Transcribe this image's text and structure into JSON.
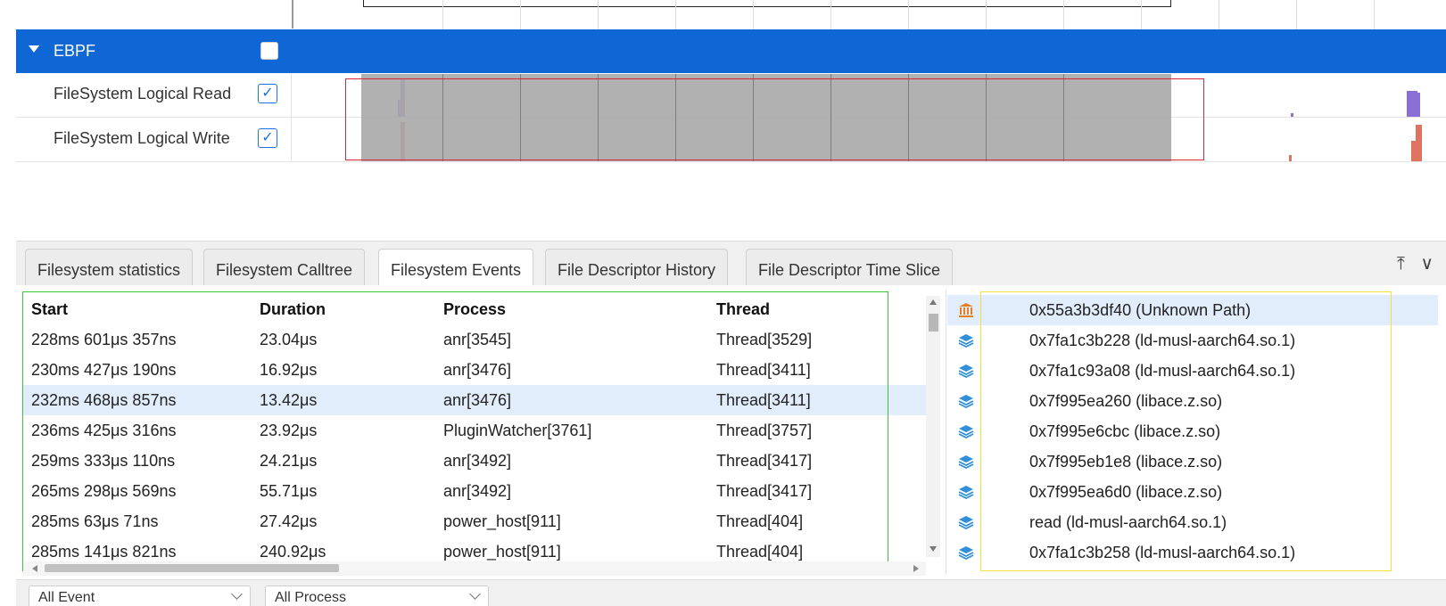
{
  "timeline": {
    "ebpf_group": {
      "label": "EBPF",
      "checked": false
    },
    "rows": [
      {
        "label": "FileSystem Logical Read",
        "checked": true,
        "bar_color": "#8a6fd6"
      },
      {
        "label": "FileSystem Logical Write",
        "checked": true,
        "bar_color": "#e0735f"
      }
    ],
    "selection_color": "#a9a9a9",
    "highlight_box_color": "#d9263a"
  },
  "tabs": [
    {
      "label": "Filesystem statistics",
      "active": false
    },
    {
      "label": "Filesystem Calltree",
      "active": false
    },
    {
      "label": "Filesystem Events",
      "active": true
    },
    {
      "label": "File Descriptor History",
      "active": false
    },
    {
      "label": "File Descriptor Time Slice",
      "active": false
    }
  ],
  "tab_icons": [
    "pin-top-icon",
    "chevron-down-icon"
  ],
  "events_table": {
    "columns": [
      "Start",
      "Duration",
      "Process",
      "Thread"
    ],
    "rows": [
      [
        "228ms 601μs 357ns",
        "23.04μs",
        "anr[3545]",
        "Thread[3529]"
      ],
      [
        "230ms 427μs 190ns",
        "16.92μs",
        "anr[3476]",
        "Thread[3411]"
      ],
      [
        "232ms 468μs 857ns",
        "13.42μs",
        "anr[3476]",
        "Thread[3411]"
      ],
      [
        "236ms 425μs 316ns",
        "23.92μs",
        "PluginWatcher[3761]",
        "Thread[3757]"
      ],
      [
        "259ms 333μs 110ns",
        "24.21μs",
        "anr[3492]",
        "Thread[3417]"
      ],
      [
        "265ms 298μs 569ns",
        "55.71μs",
        "anr[3492]",
        "Thread[3417]"
      ],
      [
        "285ms 63μs 71ns",
        "27.42μs",
        "power_host[911]",
        "Thread[404]"
      ],
      [
        "285ms 141μs 821ns",
        "240.92μs",
        "power_host[911]",
        "Thread[404]"
      ]
    ],
    "selected_row": 2,
    "box_color": "#37c837"
  },
  "call_stack": {
    "frames": [
      {
        "text": "0x55a3b3df40 (Unknown Path)",
        "icon": "bank-icon"
      },
      {
        "text": "0x7fa1c3b228 (ld-musl-aarch64.so.1)",
        "icon": "layers-icon"
      },
      {
        "text": "0x7fa1c93a08 (ld-musl-aarch64.so.1)",
        "icon": "layers-icon"
      },
      {
        "text": "0x7f995ea260 (libace.z.so)",
        "icon": "layers-icon"
      },
      {
        "text": "0x7f995e6cbc (libace.z.so)",
        "icon": "layers-icon"
      },
      {
        "text": "0x7f995eb1e8 (libace.z.so)",
        "icon": "layers-icon"
      },
      {
        "text": "0x7f995ea6d0 (libace.z.so)",
        "icon": "layers-icon"
      },
      {
        "text": "read (ld-musl-aarch64.so.1)",
        "icon": "layers-icon"
      },
      {
        "text": "0x7fa1c3b258 (ld-musl-aarch64.so.1)",
        "icon": "layers-icon"
      }
    ],
    "selected_frame": 0,
    "box_color": "#f0e33b"
  },
  "filters": {
    "event_type": "All Event",
    "process": "All Process"
  }
}
